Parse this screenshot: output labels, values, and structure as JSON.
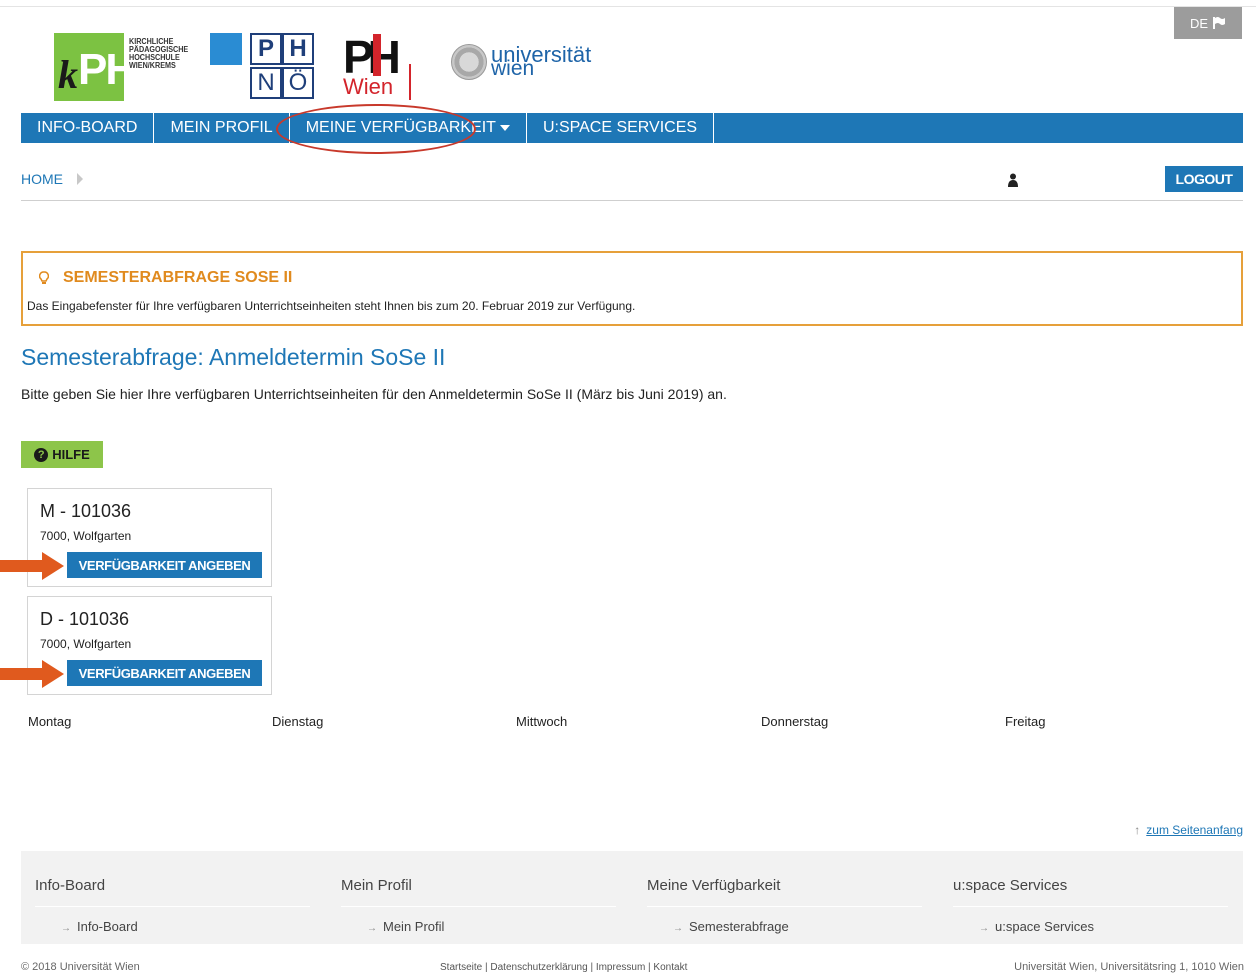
{
  "lang": {
    "label": "DE"
  },
  "logos": {
    "kph_text": [
      "KIRCHLICHE",
      "PÄDAGOGISCHE",
      "HOCHSCHULE",
      "WIEN/KREMS"
    ],
    "kph_mark": "PH",
    "phnoe": [
      "P",
      "H",
      "N",
      "Ö"
    ],
    "phwien_mark": "PH",
    "phwien_sub": "Wien",
    "uniwien": [
      "universität",
      "wien"
    ]
  },
  "nav": {
    "items": [
      "INFO-BOARD",
      "MEIN PROFIL",
      "MEINE VERFÜGBARKEIT",
      "U:SPACE SERVICES"
    ]
  },
  "breadcrumb": {
    "home": "HOME"
  },
  "logout_label": "LOGOUT",
  "notice": {
    "title": "SEMESTERABFRAGE SOSE II",
    "text": "Das Eingabefenster für Ihre verfügbaren Unterrichtseinheiten steht Ihnen bis zum 20. Februar 2019 zur Verfügung."
  },
  "main": {
    "title": "Semesterabfrage: Anmeldetermin SoSe II",
    "subtitle": "Bitte geben Sie hier Ihre verfügbaren Unterrichtseinheiten für den Anmeldetermin SoSe II (März bis Juni 2019) an.",
    "help_label": "HILFE"
  },
  "cards": [
    {
      "code": "M - 101036",
      "location": "7000, Wolfgarten",
      "button": "VERFÜGBARKEIT ANGEBEN"
    },
    {
      "code": "D - 101036",
      "location": "7000, Wolfgarten",
      "button": "VERFÜGBARKEIT ANGEBEN"
    }
  ],
  "weekdays": [
    "Montag",
    "Dienstag",
    "Mittwoch",
    "Donnerstag",
    "Freitag"
  ],
  "to_top": "zum Seitenanfang",
  "footer": {
    "columns": [
      {
        "heading": "Info-Board",
        "link": "Info-Board"
      },
      {
        "heading": "Mein Profil",
        "link": "Mein Profil"
      },
      {
        "heading": "Meine Verfügbarkeit",
        "link": "Semesterabfrage"
      },
      {
        "heading": "u:space Services",
        "link": "u:space Services"
      }
    ],
    "copyright": "© 2018 Universität Wien",
    "links": "Startseite | Datenschutzerklärung | Impressum | Kontakt",
    "address": "Universität Wien, Universitätsring 1, 1010 Wien"
  },
  "colors": {
    "brand_blue": "#1e77b6",
    "notice_orange": "#e6a03a",
    "help_green": "#8dc54a",
    "annotation_red": "#c8392b",
    "arrow_orange": "#e05a1e"
  },
  "icons": {
    "lang_flag": "flag-icon",
    "notice": "lightbulb-icon",
    "help": "question-circle-icon",
    "user": "user-icon",
    "breadcrumb_sep": "chevron-right-icon",
    "footer_link": "arrow-right-icon",
    "to_top": "arrow-up-icon"
  }
}
